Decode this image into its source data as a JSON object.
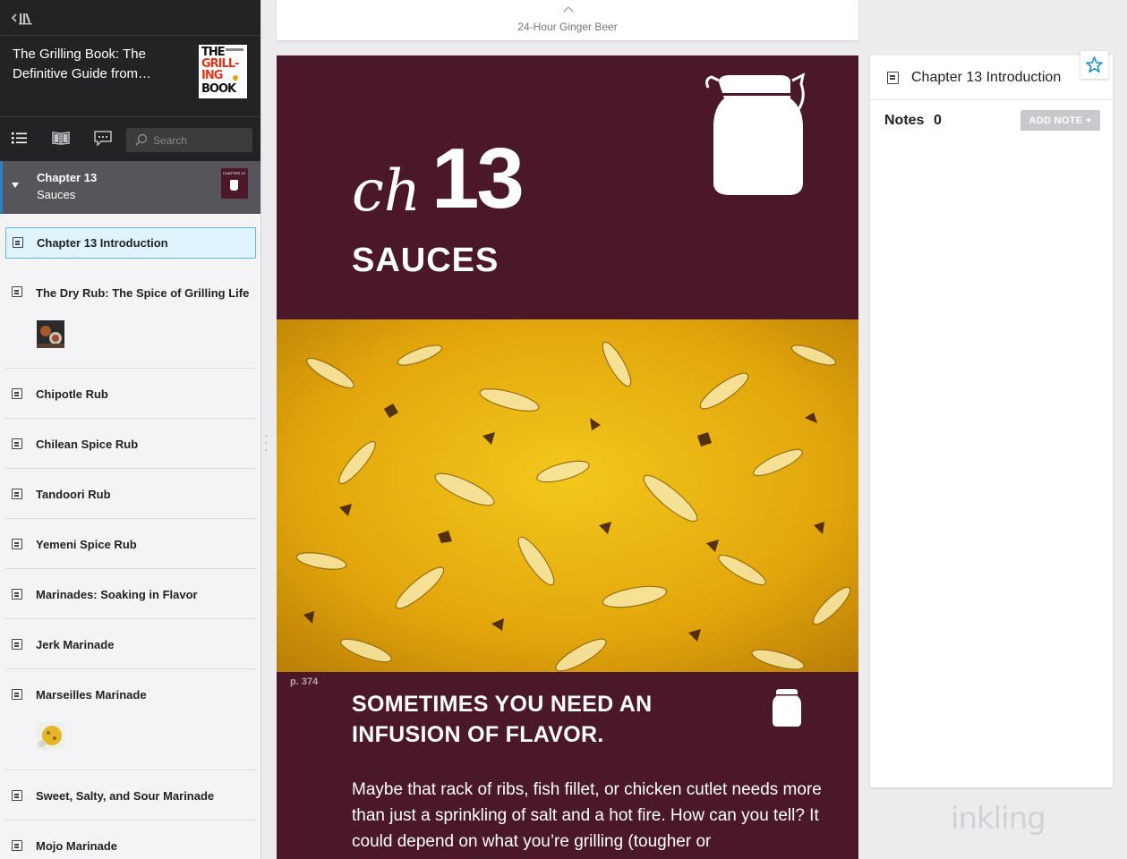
{
  "book": {
    "title_line1": "The Grilling Book: The",
    "title_line2": "Definitive Guide from…",
    "cover_lines": [
      "THE",
      "GRILL-",
      "ING",
      "BOOK"
    ]
  },
  "search": {
    "placeholder": "Search"
  },
  "chapter": {
    "number": "Chapter 13",
    "name": "Sauces",
    "thumb_text": "CHAPTER 13"
  },
  "toc": {
    "items": [
      {
        "label": "Chapter 13 Introduction",
        "active": true,
        "thumbnail": false
      },
      {
        "label": "The Dry Rub: The Spice of Grilling Life",
        "active": false,
        "thumbnail": true
      },
      {
        "label": "Chipotle Rub",
        "active": false,
        "thumbnail": false
      },
      {
        "label": "Chilean Spice Rub",
        "active": false,
        "thumbnail": false
      },
      {
        "label": "Tandoori Rub",
        "active": false,
        "thumbnail": false
      },
      {
        "label": "Yemeni Spice Rub",
        "active": false,
        "thumbnail": false
      },
      {
        "label": "Marinades: Soaking in Flavor",
        "active": false,
        "thumbnail": false
      },
      {
        "label": "Jerk Marinade",
        "active": false,
        "thumbnail": false
      },
      {
        "label": "Marseilles Marinade",
        "active": false,
        "thumbnail": true
      },
      {
        "label": "Sweet, Salty, and Sour Marinade",
        "active": false,
        "thumbnail": false
      },
      {
        "label": "Mojo Marinade",
        "active": false,
        "thumbnail": false
      }
    ]
  },
  "reader": {
    "prev_section": "24-Hour Ginger Beer",
    "ch_word": "ch",
    "ch_number": "13",
    "ch_title": "SAUCES",
    "page_number": "p. 374",
    "headline": "SOMETIMES YOU NEED AN INFUSION OF FLAVOR.",
    "body": "Maybe that rack of ribs, fish fillet, or chicken cutlet needs more than just a sprinkling of salt and a hot fire. How can you tell? It could depend on what you’re grilling (tougher or"
  },
  "notes": {
    "section_title": "Chapter 13 Introduction",
    "label": "Notes",
    "count": "0",
    "add_button": "ADD NOTE +"
  },
  "brand": {
    "logo": "inkling"
  },
  "colors": {
    "sidebar_dark": "#232325",
    "chapter_bg": "#4a1828",
    "active_item_bg": "#dff4fd",
    "active_item_border": "#5bbbe6",
    "bookmark_star": "#1a8bd6",
    "add_note_bg": "#c9c9cd"
  },
  "icons": {
    "library": "back-library-icon",
    "toc": "list-icon",
    "book": "open-book-icon",
    "notes": "speech-bubble-icon",
    "search": "magnifier-icon",
    "bookmark": "star-outline-icon",
    "jar": "jar-icon"
  }
}
